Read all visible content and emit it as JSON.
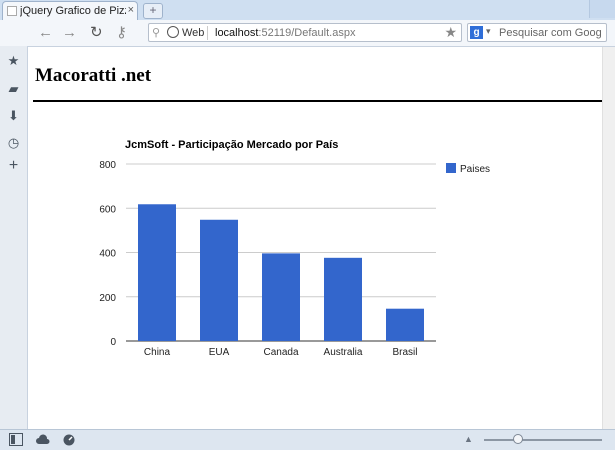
{
  "browser": {
    "tab": {
      "title": "jQuery Grafico de Pizza...",
      "close_icon": "×"
    },
    "new_tab_icon": "+",
    "toolbar": {
      "back_icon": "←",
      "forward_icon": "→",
      "reload_icon": "↻",
      "key_icon": "⚷",
      "omnibox": {
        "scheme_label": "Web",
        "url_host": "localhost",
        "url_rest": ":52119/Default.aspx",
        "pin_icon": "⚲",
        "star_icon": "★"
      },
      "search": {
        "engine_icon": "g",
        "caret_icon": "▾",
        "placeholder": "Pesquisar com Goog"
      }
    },
    "sidebar": {
      "items": [
        {
          "name": "star-icon",
          "glyph": "★"
        },
        {
          "name": "notes-icon",
          "glyph": "▰"
        },
        {
          "name": "download-icon",
          "glyph": "⬇"
        },
        {
          "name": "history-icon",
          "glyph": "◷"
        },
        {
          "name": "add-panel-icon",
          "glyph": "+"
        }
      ]
    },
    "statusbar": {
      "zoom_arrow": "▲"
    }
  },
  "page": {
    "heading": "Macoratti .net"
  },
  "chart_data": {
    "type": "bar",
    "title": "JcmSoft - Participação Mercado por País",
    "categories": [
      "China",
      "EUA",
      "Canada",
      "Australia",
      "Brasil"
    ],
    "series": [
      {
        "name": "Paises",
        "values": [
          618,
          548,
          396,
          376,
          146
        ],
        "color": "#3366cc"
      }
    ],
    "ylim": [
      0,
      800
    ],
    "yticks": [
      0,
      200,
      400,
      600,
      800
    ],
    "grid": true,
    "legend": "right"
  }
}
